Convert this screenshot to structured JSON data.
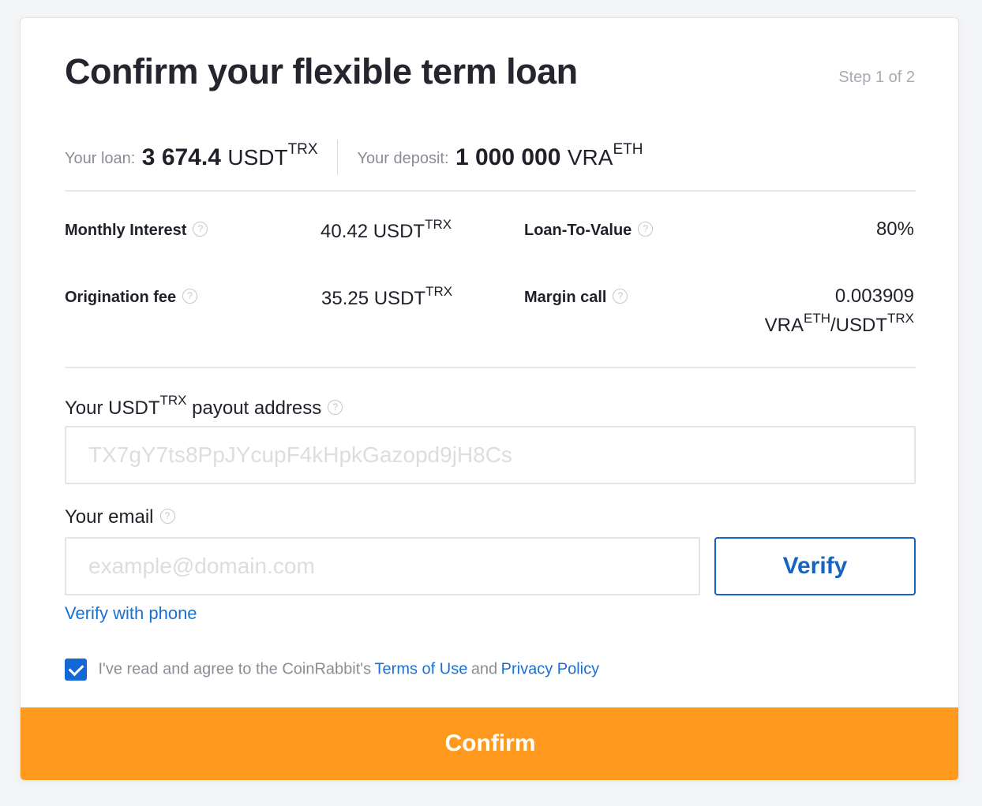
{
  "header": {
    "title": "Confirm your flexible term loan",
    "step": "Step 1 of 2"
  },
  "summary": {
    "loan_label": "Your loan:",
    "loan_amount": "3 674.4",
    "loan_currency": "USDT",
    "loan_network": "TRX",
    "deposit_label": "Your deposit:",
    "deposit_amount": "1 000 000",
    "deposit_currency": "VRA",
    "deposit_network": "ETH"
  },
  "details": {
    "monthly_interest_label": "Monthly Interest",
    "monthly_interest_value": "40.42 USDT",
    "monthly_interest_network": "TRX",
    "ltv_label": "Loan-To-Value",
    "ltv_value": "80%",
    "origination_label": "Origination fee",
    "origination_value": "35.25 USDT",
    "origination_network": "TRX",
    "margin_call_label": "Margin call",
    "margin_call_value": "0.003909",
    "margin_call_pair_base": "VRA",
    "margin_call_pair_base_net": "ETH",
    "margin_call_pair_sep": "/USDT",
    "margin_call_pair_quote_net": "TRX"
  },
  "payout": {
    "label_prefix": "Your USDT",
    "label_network": "TRX",
    "label_suffix": " payout address",
    "placeholder": "TX7gY7ts8PpJYcupF4kHpkGazopd9jH8Cs"
  },
  "email": {
    "label": "Your email",
    "placeholder": "example@domain.com",
    "verify_label": "Verify",
    "verify_phone_label": "Verify with phone"
  },
  "agreement": {
    "checked": true,
    "text": "I've read and agree to the CoinRabbit's",
    "terms_label": "Terms of Use",
    "and_text": "and",
    "privacy_label": "Privacy Policy"
  },
  "footer": {
    "confirm_label": "Confirm"
  },
  "icons": {
    "help": "question-circle-icon",
    "check": "checkmark-icon"
  },
  "colors": {
    "accent": "#ff9a1f",
    "link": "#1a6fd1",
    "verify_border": "#1764c0",
    "checkbox": "#1468d6"
  }
}
